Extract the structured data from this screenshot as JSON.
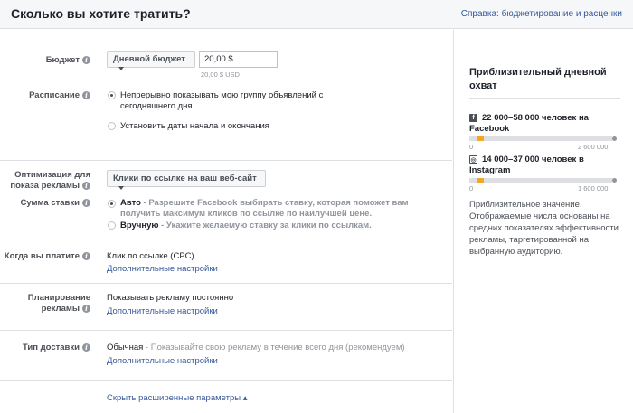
{
  "header": {
    "title": "Сколько вы хотите тратить?",
    "help_link": "Справка: бюджетирование и расценки"
  },
  "budget": {
    "label": "Бюджет",
    "type_selected": "Дневной бюджет",
    "amount_value": "20,00 $",
    "amount_hint": "20,00 $ USD"
  },
  "schedule": {
    "label": "Расписание",
    "options": [
      {
        "label": "Непрерывно показывать мою группу объявлений с сегодняшнего дня",
        "selected": true
      },
      {
        "label": "Установить даты начала и окончания",
        "selected": false
      }
    ]
  },
  "optimization": {
    "label": "Оптимизация для показа рекламы",
    "selected": "Клики по ссылке на ваш веб-сайт"
  },
  "bid": {
    "label": "Сумма ставки",
    "options": [
      {
        "title": "Авто",
        "desc": " - Разрешите Facebook выбирать ставку, которая поможет вам получить максимум кликов по ссылке по наилучшей цене.",
        "selected": true
      },
      {
        "title": "Вручную",
        "desc": " - Укажите желаемую ставку за клики по ссылкам.",
        "selected": false
      }
    ]
  },
  "when_pay": {
    "label": "Когда вы платите",
    "value": "Клик по ссылке (CPC)",
    "link": "Дополнительные настройки"
  },
  "ad_scheduling": {
    "label": "Планирование рекламы",
    "value": "Показывать рекламу постоянно",
    "link": "Дополнительные настройки"
  },
  "delivery": {
    "label": "Тип доставки",
    "value_bold": "Обычная",
    "value_rest": " - Показывайте свою рекламу в течение всего дня (рекомендуем)",
    "link": "Дополнительные настройки"
  },
  "hide_advanced": "Скрыть расширенные параметры ▴",
  "reach": {
    "title": "Приблизительный дневной охват",
    "platforms": [
      {
        "icon": "facebook-icon",
        "text": "22 000–58 000 человек на Facebook",
        "scale_min": "0",
        "scale_max": "2 600 000",
        "fill_start": 0.06,
        "fill_end": 0.1
      },
      {
        "icon": "instagram-icon",
        "text": "14 000–37 000 человек в Instagram",
        "scale_min": "0",
        "scale_max": "1 600 000",
        "fill_start": 0.06,
        "fill_end": 0.1
      }
    ],
    "note": "Приблизительное значение. Отображаемые числа основаны на средних показателях эффективности рекламы, таргетированной на выбранную аудиторию."
  },
  "colors": {
    "link": "#365899",
    "reach_fill": "#f5a623",
    "header_bg": "#f6f7f9"
  }
}
